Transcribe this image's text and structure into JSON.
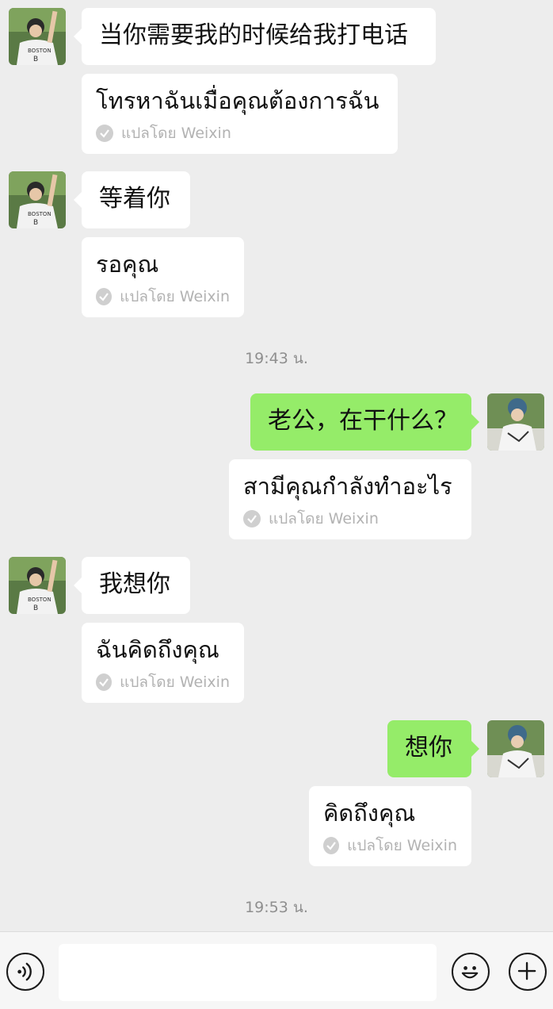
{
  "conversation": {
    "messages": [
      {
        "sender": "friend",
        "text": "当你需要我的时候给我打电话",
        "translation": "โทรหาฉันเมื่อคุณต้องการฉัน",
        "translated_by": "แปลโดย Weixin"
      },
      {
        "sender": "friend",
        "text": "等着你",
        "translation": "รอคุณ",
        "translated_by": "แปลโดย Weixin"
      },
      {
        "sender": "me",
        "text": "老公，在干什么？",
        "translation": "สามีคุณกำลังทำอะไร",
        "translated_by": "แปลโดย Weixin"
      },
      {
        "sender": "friend",
        "text": "我想你",
        "translation": "ฉันคิดถึงคุณ",
        "translated_by": "แปลโดย Weixin"
      },
      {
        "sender": "me",
        "text": "想你",
        "translation": "คิดถึงคุณ",
        "translated_by": "แปลโดย Weixin"
      }
    ],
    "timestamps": [
      "19:43 น.",
      "19:53 น."
    ]
  },
  "input_bar": {
    "placeholder": "",
    "icons": [
      "voice-icon",
      "emoji-icon",
      "plus-icon"
    ]
  },
  "colors": {
    "background": "#ededed",
    "my_bubble": "#95ec69",
    "friend_bubble": "#ffffff",
    "meta_text": "#b2b2b2"
  }
}
